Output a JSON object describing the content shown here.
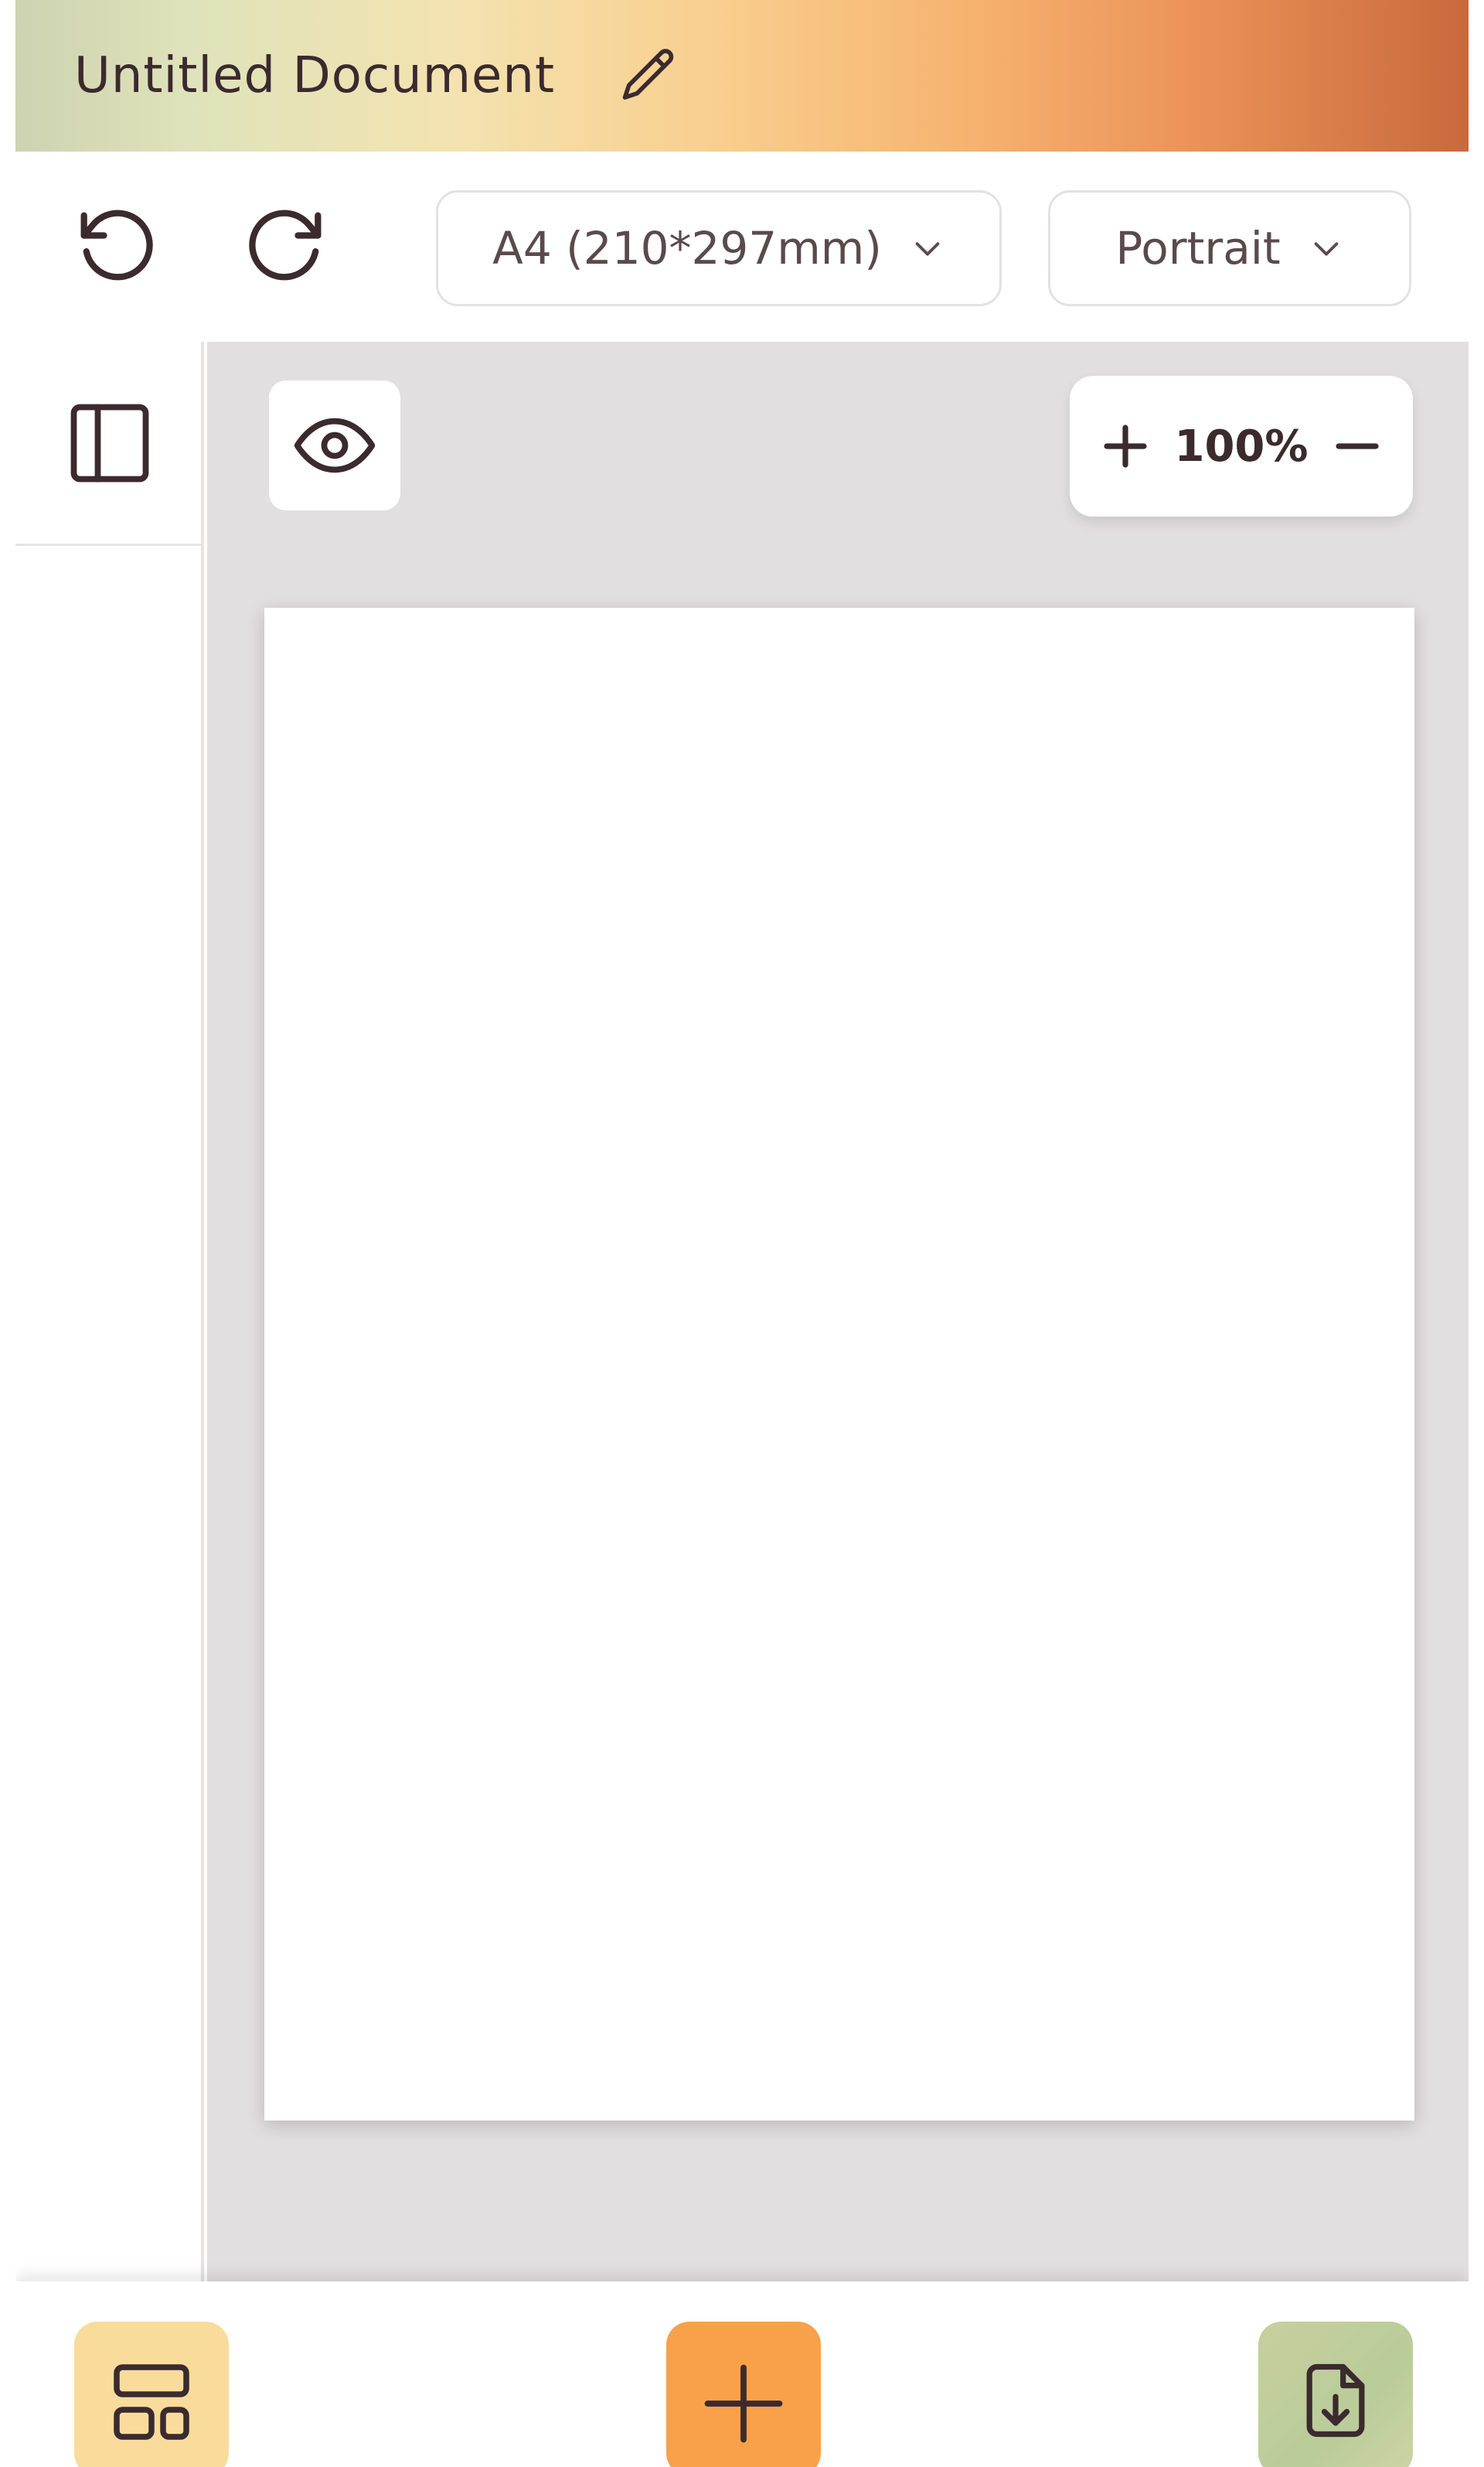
{
  "header": {
    "title": "Untitled Document",
    "edit_icon": "pencil-icon",
    "gradient_colors": [
      "#cdd3b0",
      "#f3e3b0",
      "#f9cf8f",
      "#f6b26f",
      "#c9693c"
    ]
  },
  "toolbar": {
    "undo_icon": "undo-icon",
    "redo_icon": "redo-icon",
    "paper_size": "A4 (210*297mm)",
    "orientation": "Portrait"
  },
  "sidebar": {
    "toggle_icon": "sidebar-panel-icon"
  },
  "canvas": {
    "preview_icon": "eye-icon",
    "zoom_level": "100%",
    "background_color": "#e2dfe0"
  },
  "bottom_bar": {
    "layout_icon": "layout-icon",
    "add_icon": "plus-icon",
    "export_icon": "file-download-icon",
    "colors": {
      "layout": "#f9dc9c",
      "add": "#f9a14a",
      "export": "#c8cf9e"
    }
  }
}
